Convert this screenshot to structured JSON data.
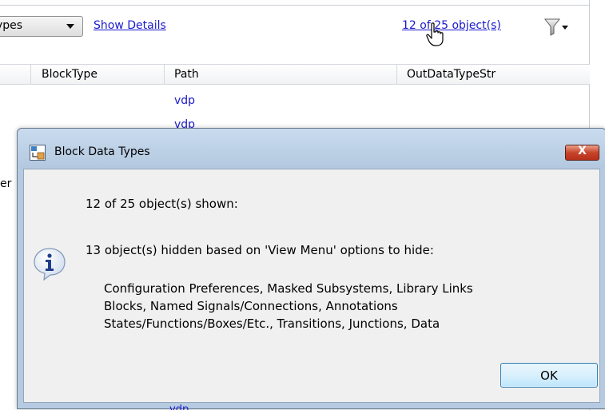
{
  "toolbar": {
    "type_combo_text": "ypes",
    "show_details_link": "Show Details",
    "object_count_link": "12 of 25 object(s)",
    "filter_icon": "filter-dropdown-icon",
    "cursor_icon": "hand-pointer-icon"
  },
  "grid": {
    "columns": [
      "BlockType",
      "Path",
      "OutDataTypeStr"
    ],
    "rows": [
      {
        "path": "vdp"
      },
      {
        "path": "vdp"
      }
    ],
    "left_clip_text": "er",
    "bottom_clip_text": "vdp"
  },
  "dialog": {
    "title": "Block Data Types",
    "app_icon": "simulink-icon",
    "info_icon": "information-icon",
    "close_label": "X",
    "line1": "12 of 25 object(s) shown:",
    "line2": "13 object(s) hidden based on 'View Menu' options to hide:",
    "detail_lines": [
      "Configuration Preferences, Masked Subsystems, Library Links",
      "Blocks, Named Signals/Connections, Annotations",
      "States/Functions/Boxes/Etc., Transitions, Junctions, Data"
    ],
    "ok_label": "OK"
  },
  "colors": {
    "link": "#1a1acb",
    "dialog_frame": "#b6cbe2",
    "close_button": "#c7442b",
    "ok_button_border": "#3c7fb1"
  }
}
